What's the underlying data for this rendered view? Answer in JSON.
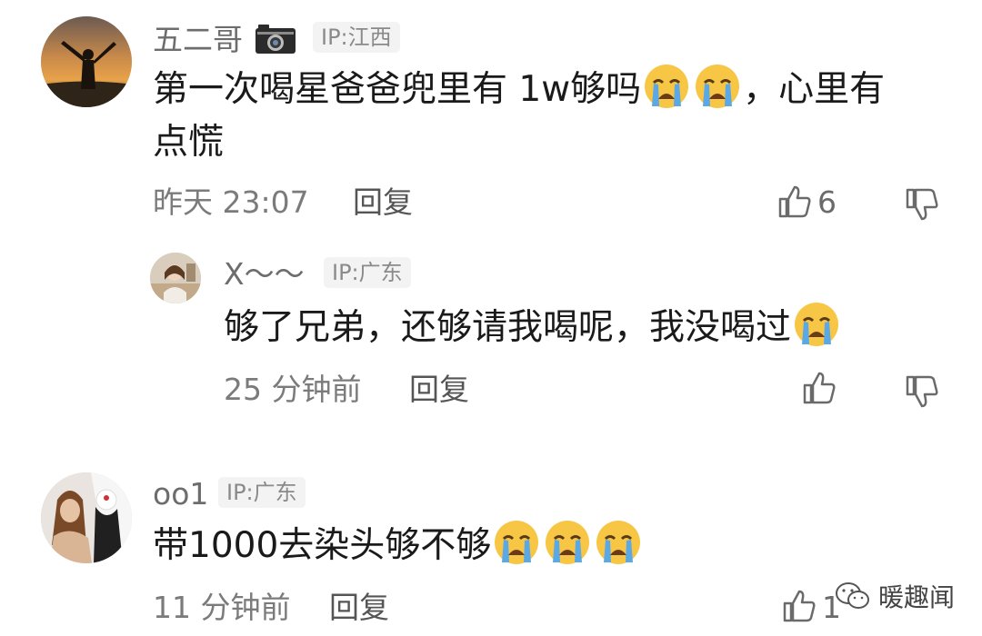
{
  "comments": [
    {
      "username": "五二哥",
      "ip": "IP:江西",
      "text_line1": "第一次喝星爸爸兜里有 1w够吗",
      "text_line1_tail": "，心里有",
      "text_line2": "点慌",
      "time": "昨天 23:07",
      "reply_label": "回复",
      "likes": "6"
    },
    {
      "username": "X～～",
      "ip": "IP:广东",
      "text": "够了兄弟，还够请我喝呢，我没喝过",
      "time": "25 分钟前",
      "reply_label": "回复"
    },
    {
      "username": "oo1",
      "ip": "IP:广东",
      "text": "带1000去染头够不够",
      "time": "11 分钟前",
      "reply_label": "回复",
      "likes": "1"
    }
  ],
  "watermark": {
    "text": "暖趣闻"
  },
  "icons": {
    "like": "thumbs-up-icon",
    "dislike": "thumbs-down-icon",
    "emoji": "loudly-crying-face-emoji",
    "camera": "camera-icon",
    "wechat": "wechat-logo-icon"
  },
  "colors": {
    "text": "#1a1a1a",
    "meta": "#7b7b7b",
    "emoji_face": "#f7c644",
    "tear": "#5aa9e6"
  }
}
